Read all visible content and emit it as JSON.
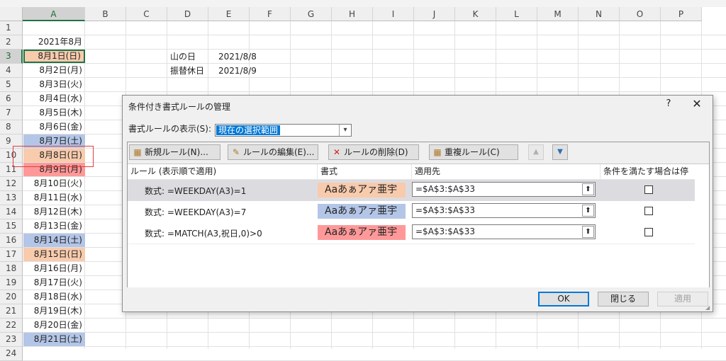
{
  "sheet": {
    "columns": [
      "A",
      "B",
      "C",
      "D",
      "E",
      "F",
      "G",
      "H",
      "I",
      "J",
      "K",
      "L",
      "M",
      "N",
      "O",
      "P"
    ],
    "rows": [
      "1",
      "2",
      "3",
      "4",
      "5",
      "6",
      "7",
      "8",
      "9",
      "10",
      "11",
      "12",
      "13",
      "14",
      "15",
      "16",
      "17",
      "18",
      "19",
      "20",
      "21",
      "22",
      "23",
      "24"
    ],
    "col_a_cells": [
      "",
      "2021年8月",
      "8月1日(日)",
      "8月2日(月)",
      "8月3日(火)",
      "8月4日(水)",
      "8月5日(木)",
      "8月6日(金)",
      "8月7日(土)",
      "8月8日(日)",
      "8月9日(月)",
      "8月10日(火)",
      "8月11日(水)",
      "8月12日(木)",
      "8月13日(金)",
      "8月14日(土)",
      "8月15日(日)",
      "8月16日(月)",
      "8月17日(火)",
      "8月18日(水)",
      "8月19日(木)",
      "8月20日(金)",
      "8月21日(土)",
      ""
    ],
    "holidays": [
      {
        "name": "山の日",
        "date": "2021/8/8"
      },
      {
        "name": "振替休日",
        "date": "2021/8/9"
      }
    ],
    "highlight_colors": {
      "sunday": "#f8cbad",
      "saturday": "#b4c6e7",
      "holiday": "#ff9999"
    }
  },
  "dialog": {
    "title": "条件付き書式ルールの管理",
    "help": "?",
    "close": "✕",
    "show_rules_label": "書式ルールの表示(S):",
    "show_rules_value": "現在の選択範囲",
    "toolbar": {
      "new_rule": "新規ルール(N)...",
      "edit_rule": "ルールの編集(E)...",
      "delete_rule": "ルールの削除(D)",
      "duplicate_rule": "重複ルール(C)"
    },
    "headers": {
      "rule": "ルール (表示順で適用)",
      "format": "書式",
      "applies_to": "適用先",
      "stop_if_true": "条件を満たす場合は停止"
    },
    "rules": [
      {
        "rule": "数式: =WEEKDAY(A3)=1",
        "preview": "Aaあぁアァ亜宇",
        "applies_to": "=$A$3:$A$33",
        "color": "#f8cbad"
      },
      {
        "rule": "数式: =WEEKDAY(A3)=7",
        "preview": "Aaあぁアァ亜宇",
        "applies_to": "=$A$3:$A$33",
        "color": "#b4c6e7"
      },
      {
        "rule": "数式: =MATCH(A3,祝日,0)>0",
        "preview": "Aaあぁアァ亜宇",
        "applies_to": "=$A$3:$A$33",
        "color": "#ff9999"
      }
    ],
    "buttons": {
      "ok": "OK",
      "close": "閉じる",
      "apply": "適用"
    }
  }
}
